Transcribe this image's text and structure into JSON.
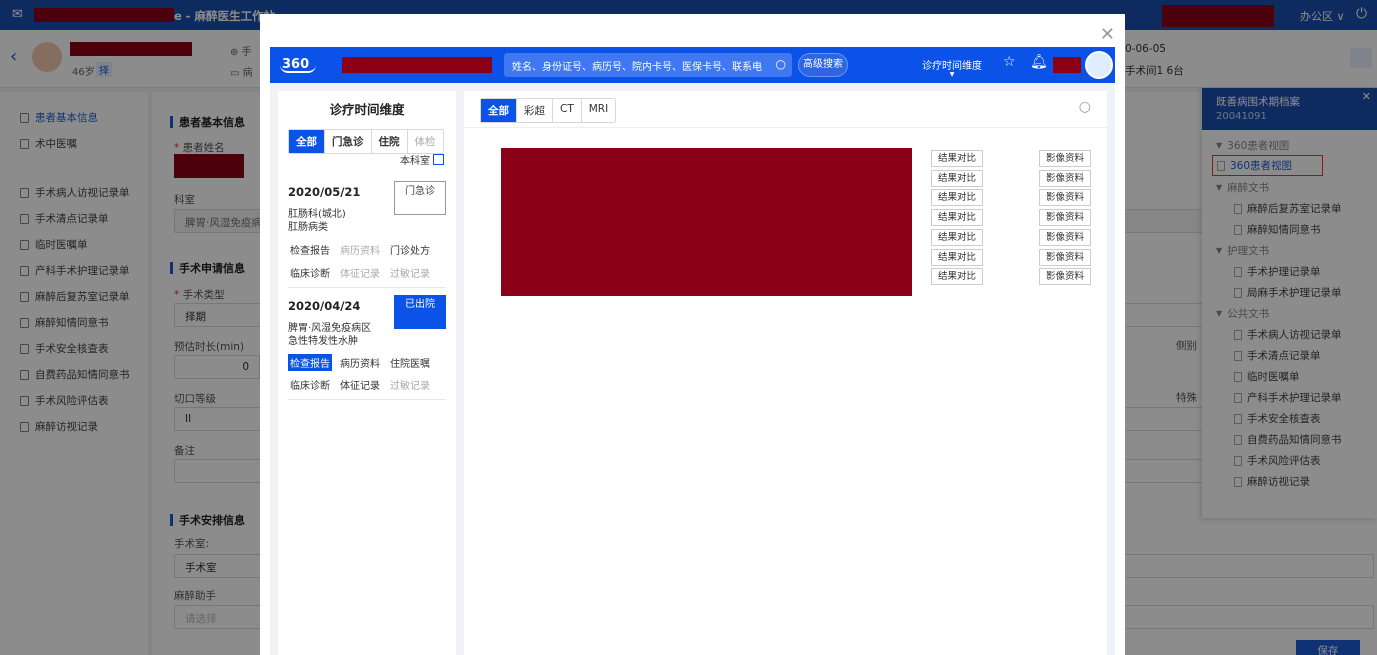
{
  "app": {
    "title_suffix": "e - 麻醉医生工作站",
    "office_label": "办公区",
    "accent": "#1b4fb0"
  },
  "patient": {
    "age_label": "46岁",
    "badge": "择",
    "date_partial": "0-06-05",
    "room_info": "手术间1 6台",
    "row1_prefix": "手",
    "row2_prefix": "病"
  },
  "left_nav": {
    "items": [
      "患者基本信息",
      "术中医嘱",
      "手术病人访视记录单",
      "手术清点记录单",
      "临时医嘱单",
      "产科手术护理记录单",
      "麻醉后复苏室记录单",
      "麻醉知情同意书",
      "手术安全核查表",
      "自费药品知情同意书",
      "手术风险评估表",
      "麻醉访视记录"
    ]
  },
  "form": {
    "sec_basic": "患者基本信息",
    "patient_name_label": "患者姓名",
    "dept_label": "科室",
    "dept_value": "脾胃·风湿免疫病",
    "sec_request": "手术申请信息",
    "op_type_label": "手术类型",
    "op_type_value": "择期",
    "duration_label": "预估时长(min)",
    "duration_value": "0",
    "incision_label": "切口等级",
    "incision_value": "II",
    "remark_label": "备注",
    "sec_schedule": "手术安排信息",
    "room_label": "手术室:",
    "room_value": "手术室",
    "assistant_label": "麻醉助手",
    "assistant_placeholder": "请选择",
    "side_label": "侧别",
    "special_label": "特殊",
    "save": "保存"
  },
  "right_panel": {
    "title": "既善病围术期档案",
    "id": "20041091",
    "groups": [
      {
        "name": "360患者视图",
        "items": [
          "360患者视图"
        ]
      },
      {
        "name": "麻醉文书",
        "items": [
          "麻醉后复苏室记录单",
          "麻醉知情同意书"
        ]
      },
      {
        "name": "护理文书",
        "items": [
          "手术护理记录单",
          "局麻手术护理记录单"
        ]
      },
      {
        "name": "公共文书",
        "items": [
          "手术病人访视记录单",
          "手术清点记录单",
          "临时医嘱单",
          "产科手术护理记录单",
          "手术安全核查表",
          "自费药品知情同意书",
          "手术风险评估表",
          "麻醉访视记录"
        ]
      }
    ]
  },
  "modal": {
    "logo": "360",
    "search_placeholder": "姓名、身份证号、病历号、院内卡号、医保卡号、联系电",
    "advanced_search": "高级搜索",
    "dimension": "诊疗时间维度",
    "timeline": {
      "title": "诊疗时间维度",
      "filters": [
        "全部",
        "门急诊",
        "住院",
        "体检"
      ],
      "dept_only": "本科室",
      "visits": [
        {
          "date": "2020/05/21",
          "dept": "肛肠科(城北)",
          "diag": "肛肠病类",
          "status": "门急诊",
          "links1": [
            "检查报告",
            "病历资料",
            "门诊处方"
          ],
          "links2": [
            "临床诊断",
            "体征记录",
            "过敏记录"
          ]
        },
        {
          "date": "2020/04/24",
          "dept": "脾胃·风湿免疫病区",
          "diag": "急性特发性水肿",
          "status": "已出院",
          "links1": [
            "检查报告",
            "病历资料",
            "住院医嘱"
          ],
          "links2": [
            "临床诊断",
            "体征记录",
            "过敏记录"
          ]
        }
      ]
    },
    "content": {
      "tabs": [
        "全部",
        "彩超",
        "CT",
        "MRI"
      ],
      "compare_label": "结果对比",
      "image_label": "影像资料",
      "rows": 7
    }
  }
}
